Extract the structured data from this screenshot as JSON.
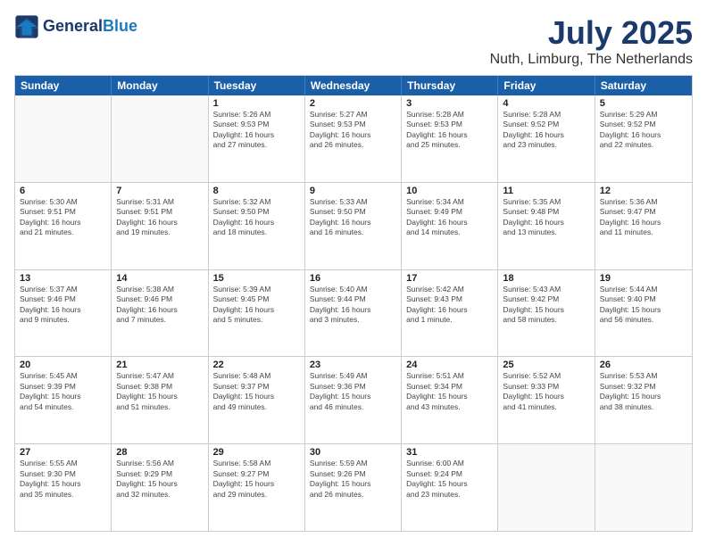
{
  "header": {
    "logo_line1": "General",
    "logo_line2": "Blue",
    "month": "July 2025",
    "location": "Nuth, Limburg, The Netherlands"
  },
  "weekdays": [
    "Sunday",
    "Monday",
    "Tuesday",
    "Wednesday",
    "Thursday",
    "Friday",
    "Saturday"
  ],
  "rows": [
    [
      {
        "day": "",
        "text": ""
      },
      {
        "day": "",
        "text": ""
      },
      {
        "day": "1",
        "text": "Sunrise: 5:26 AM\nSunset: 9:53 PM\nDaylight: 16 hours\nand 27 minutes."
      },
      {
        "day": "2",
        "text": "Sunrise: 5:27 AM\nSunset: 9:53 PM\nDaylight: 16 hours\nand 26 minutes."
      },
      {
        "day": "3",
        "text": "Sunrise: 5:28 AM\nSunset: 9:53 PM\nDaylight: 16 hours\nand 25 minutes."
      },
      {
        "day": "4",
        "text": "Sunrise: 5:28 AM\nSunset: 9:52 PM\nDaylight: 16 hours\nand 23 minutes."
      },
      {
        "day": "5",
        "text": "Sunrise: 5:29 AM\nSunset: 9:52 PM\nDaylight: 16 hours\nand 22 minutes."
      }
    ],
    [
      {
        "day": "6",
        "text": "Sunrise: 5:30 AM\nSunset: 9:51 PM\nDaylight: 16 hours\nand 21 minutes."
      },
      {
        "day": "7",
        "text": "Sunrise: 5:31 AM\nSunset: 9:51 PM\nDaylight: 16 hours\nand 19 minutes."
      },
      {
        "day": "8",
        "text": "Sunrise: 5:32 AM\nSunset: 9:50 PM\nDaylight: 16 hours\nand 18 minutes."
      },
      {
        "day": "9",
        "text": "Sunrise: 5:33 AM\nSunset: 9:50 PM\nDaylight: 16 hours\nand 16 minutes."
      },
      {
        "day": "10",
        "text": "Sunrise: 5:34 AM\nSunset: 9:49 PM\nDaylight: 16 hours\nand 14 minutes."
      },
      {
        "day": "11",
        "text": "Sunrise: 5:35 AM\nSunset: 9:48 PM\nDaylight: 16 hours\nand 13 minutes."
      },
      {
        "day": "12",
        "text": "Sunrise: 5:36 AM\nSunset: 9:47 PM\nDaylight: 16 hours\nand 11 minutes."
      }
    ],
    [
      {
        "day": "13",
        "text": "Sunrise: 5:37 AM\nSunset: 9:46 PM\nDaylight: 16 hours\nand 9 minutes."
      },
      {
        "day": "14",
        "text": "Sunrise: 5:38 AM\nSunset: 9:46 PM\nDaylight: 16 hours\nand 7 minutes."
      },
      {
        "day": "15",
        "text": "Sunrise: 5:39 AM\nSunset: 9:45 PM\nDaylight: 16 hours\nand 5 minutes."
      },
      {
        "day": "16",
        "text": "Sunrise: 5:40 AM\nSunset: 9:44 PM\nDaylight: 16 hours\nand 3 minutes."
      },
      {
        "day": "17",
        "text": "Sunrise: 5:42 AM\nSunset: 9:43 PM\nDaylight: 16 hours\nand 1 minute."
      },
      {
        "day": "18",
        "text": "Sunrise: 5:43 AM\nSunset: 9:42 PM\nDaylight: 15 hours\nand 58 minutes."
      },
      {
        "day": "19",
        "text": "Sunrise: 5:44 AM\nSunset: 9:40 PM\nDaylight: 15 hours\nand 56 minutes."
      }
    ],
    [
      {
        "day": "20",
        "text": "Sunrise: 5:45 AM\nSunset: 9:39 PM\nDaylight: 15 hours\nand 54 minutes."
      },
      {
        "day": "21",
        "text": "Sunrise: 5:47 AM\nSunset: 9:38 PM\nDaylight: 15 hours\nand 51 minutes."
      },
      {
        "day": "22",
        "text": "Sunrise: 5:48 AM\nSunset: 9:37 PM\nDaylight: 15 hours\nand 49 minutes."
      },
      {
        "day": "23",
        "text": "Sunrise: 5:49 AM\nSunset: 9:36 PM\nDaylight: 15 hours\nand 46 minutes."
      },
      {
        "day": "24",
        "text": "Sunrise: 5:51 AM\nSunset: 9:34 PM\nDaylight: 15 hours\nand 43 minutes."
      },
      {
        "day": "25",
        "text": "Sunrise: 5:52 AM\nSunset: 9:33 PM\nDaylight: 15 hours\nand 41 minutes."
      },
      {
        "day": "26",
        "text": "Sunrise: 5:53 AM\nSunset: 9:32 PM\nDaylight: 15 hours\nand 38 minutes."
      }
    ],
    [
      {
        "day": "27",
        "text": "Sunrise: 5:55 AM\nSunset: 9:30 PM\nDaylight: 15 hours\nand 35 minutes."
      },
      {
        "day": "28",
        "text": "Sunrise: 5:56 AM\nSunset: 9:29 PM\nDaylight: 15 hours\nand 32 minutes."
      },
      {
        "day": "29",
        "text": "Sunrise: 5:58 AM\nSunset: 9:27 PM\nDaylight: 15 hours\nand 29 minutes."
      },
      {
        "day": "30",
        "text": "Sunrise: 5:59 AM\nSunset: 9:26 PM\nDaylight: 15 hours\nand 26 minutes."
      },
      {
        "day": "31",
        "text": "Sunrise: 6:00 AM\nSunset: 9:24 PM\nDaylight: 15 hours\nand 23 minutes."
      },
      {
        "day": "",
        "text": ""
      },
      {
        "day": "",
        "text": ""
      }
    ]
  ]
}
